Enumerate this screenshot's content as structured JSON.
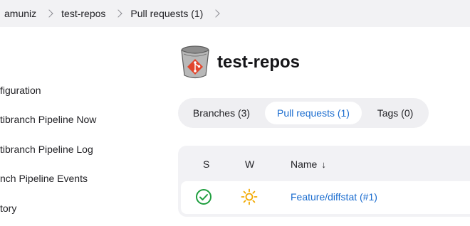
{
  "breadcrumb": {
    "items": [
      "amuniz",
      "test-repos",
      "Pull requests (1)"
    ]
  },
  "sidebar": {
    "items": [
      {
        "label": "figuration"
      },
      {
        "label": "tibranch Pipeline Now"
      },
      {
        "label": "tibranch Pipeline Log"
      },
      {
        "label": "nch Pipeline Events"
      },
      {
        "label": "tory"
      }
    ]
  },
  "project": {
    "title": "test-repos",
    "icon": "git-repo-bucket-icon"
  },
  "tabs": [
    {
      "label": "Branches (3)",
      "active": false
    },
    {
      "label": "Pull requests (1)",
      "active": true
    },
    {
      "label": "Tags (0)",
      "active": false
    }
  ],
  "table": {
    "headers": {
      "status": "S",
      "weather": "W",
      "name": "Name",
      "sort_indicator": "↓"
    },
    "rows": [
      {
        "status_icon": "success-check-icon",
        "weather_icon": "sunny-icon",
        "name": "Feature/diffstat (#1)"
      }
    ]
  },
  "colors": {
    "accent": "#1a6ccf",
    "success": "#1e9e3e",
    "sunny": "#f2a900",
    "breadcrumb_bg": "#f2f2f4"
  }
}
